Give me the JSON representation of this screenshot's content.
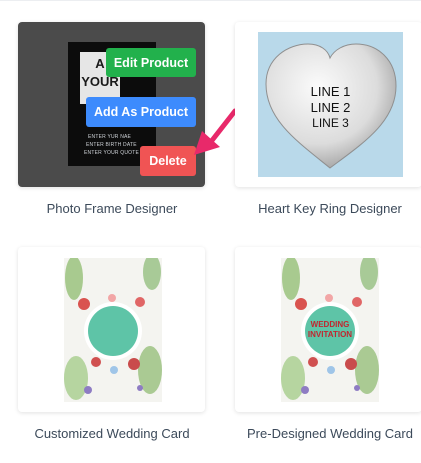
{
  "products": [
    {
      "title": "Photo Frame Designer",
      "hover_actions": {
        "edit": "Edit Product",
        "add": "Add As Product",
        "delete": "Delete"
      },
      "frame_preview": {
        "big_text_1": "A",
        "big_text_2": "YOUR",
        "line_1": "ENTER YUR NAE",
        "line_2": "ENTER BIRTH DATE",
        "line_3": "ENTER YOUR QUOTE"
      }
    },
    {
      "title": "Heart Key Ring Designer",
      "heart_lines": [
        "LINE 1",
        "LINE 2",
        "LINE 3"
      ]
    },
    {
      "title": "Customized Wedding Card"
    },
    {
      "title": "Pre-Designed Wedding Card",
      "badge": [
        "WEDDING",
        "INVITATION"
      ]
    }
  ],
  "colors": {
    "edit": "#22b14c",
    "add": "#3d8bfd",
    "delete": "#f05454",
    "arrow": "#e8296a",
    "badge": "#5ec4a7",
    "badge_text": "#c0262f"
  }
}
